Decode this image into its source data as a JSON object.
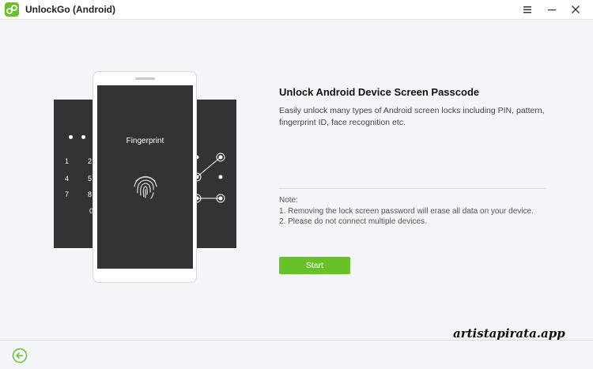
{
  "app": {
    "title": "UnlockGo (Android)",
    "accent_color": "#69c12a",
    "logo_icon": "link-logo-icon"
  },
  "window_controls": {
    "menu_icon": "hamburger-menu-icon",
    "minimize_icon": "minimize-icon",
    "close_icon": "close-icon"
  },
  "illustration": {
    "center_phone_label": "Fingerprint",
    "center_icon": "fingerprint-icon",
    "pin_keys": [
      "1",
      "2",
      "4",
      "5",
      "7",
      "8",
      "0"
    ],
    "pattern_icon": "pattern-lock-icon"
  },
  "content": {
    "title": "Unlock Android Device Screen Passcode",
    "description": "Easily unlock many types of Android screen locks including PIN, pattern, fingerprint ID, face recognition etc.",
    "note_title": "Note:",
    "notes": [
      "1. Removing the lock screen password will erase all data on your device.",
      "2. Please do not connect multiple devices."
    ],
    "start_label": "Start"
  },
  "watermark": "artistapirata.app",
  "footer": {
    "back_icon": "back-arrow-icon"
  }
}
